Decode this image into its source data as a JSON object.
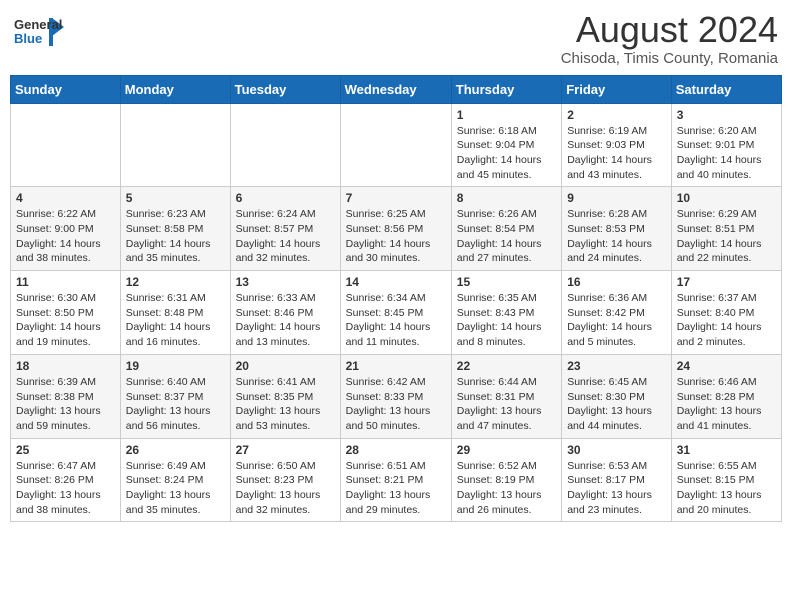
{
  "header": {
    "logo_general": "General",
    "logo_blue": "Blue",
    "month_year": "August 2024",
    "location": "Chisoda, Timis County, Romania"
  },
  "days_of_week": [
    "Sunday",
    "Monday",
    "Tuesday",
    "Wednesday",
    "Thursday",
    "Friday",
    "Saturday"
  ],
  "weeks": [
    [
      {
        "day": "",
        "info": ""
      },
      {
        "day": "",
        "info": ""
      },
      {
        "day": "",
        "info": ""
      },
      {
        "day": "",
        "info": ""
      },
      {
        "day": "1",
        "info": "Sunrise: 6:18 AM\nSunset: 9:04 PM\nDaylight: 14 hours\nand 45 minutes."
      },
      {
        "day": "2",
        "info": "Sunrise: 6:19 AM\nSunset: 9:03 PM\nDaylight: 14 hours\nand 43 minutes."
      },
      {
        "day": "3",
        "info": "Sunrise: 6:20 AM\nSunset: 9:01 PM\nDaylight: 14 hours\nand 40 minutes."
      }
    ],
    [
      {
        "day": "4",
        "info": "Sunrise: 6:22 AM\nSunset: 9:00 PM\nDaylight: 14 hours\nand 38 minutes."
      },
      {
        "day": "5",
        "info": "Sunrise: 6:23 AM\nSunset: 8:58 PM\nDaylight: 14 hours\nand 35 minutes."
      },
      {
        "day": "6",
        "info": "Sunrise: 6:24 AM\nSunset: 8:57 PM\nDaylight: 14 hours\nand 32 minutes."
      },
      {
        "day": "7",
        "info": "Sunrise: 6:25 AM\nSunset: 8:56 PM\nDaylight: 14 hours\nand 30 minutes."
      },
      {
        "day": "8",
        "info": "Sunrise: 6:26 AM\nSunset: 8:54 PM\nDaylight: 14 hours\nand 27 minutes."
      },
      {
        "day": "9",
        "info": "Sunrise: 6:28 AM\nSunset: 8:53 PM\nDaylight: 14 hours\nand 24 minutes."
      },
      {
        "day": "10",
        "info": "Sunrise: 6:29 AM\nSunset: 8:51 PM\nDaylight: 14 hours\nand 22 minutes."
      }
    ],
    [
      {
        "day": "11",
        "info": "Sunrise: 6:30 AM\nSunset: 8:50 PM\nDaylight: 14 hours\nand 19 minutes."
      },
      {
        "day": "12",
        "info": "Sunrise: 6:31 AM\nSunset: 8:48 PM\nDaylight: 14 hours\nand 16 minutes."
      },
      {
        "day": "13",
        "info": "Sunrise: 6:33 AM\nSunset: 8:46 PM\nDaylight: 14 hours\nand 13 minutes."
      },
      {
        "day": "14",
        "info": "Sunrise: 6:34 AM\nSunset: 8:45 PM\nDaylight: 14 hours\nand 11 minutes."
      },
      {
        "day": "15",
        "info": "Sunrise: 6:35 AM\nSunset: 8:43 PM\nDaylight: 14 hours\nand 8 minutes."
      },
      {
        "day": "16",
        "info": "Sunrise: 6:36 AM\nSunset: 8:42 PM\nDaylight: 14 hours\nand 5 minutes."
      },
      {
        "day": "17",
        "info": "Sunrise: 6:37 AM\nSunset: 8:40 PM\nDaylight: 14 hours\nand 2 minutes."
      }
    ],
    [
      {
        "day": "18",
        "info": "Sunrise: 6:39 AM\nSunset: 8:38 PM\nDaylight: 13 hours\nand 59 minutes."
      },
      {
        "day": "19",
        "info": "Sunrise: 6:40 AM\nSunset: 8:37 PM\nDaylight: 13 hours\nand 56 minutes."
      },
      {
        "day": "20",
        "info": "Sunrise: 6:41 AM\nSunset: 8:35 PM\nDaylight: 13 hours\nand 53 minutes."
      },
      {
        "day": "21",
        "info": "Sunrise: 6:42 AM\nSunset: 8:33 PM\nDaylight: 13 hours\nand 50 minutes."
      },
      {
        "day": "22",
        "info": "Sunrise: 6:44 AM\nSunset: 8:31 PM\nDaylight: 13 hours\nand 47 minutes."
      },
      {
        "day": "23",
        "info": "Sunrise: 6:45 AM\nSunset: 8:30 PM\nDaylight: 13 hours\nand 44 minutes."
      },
      {
        "day": "24",
        "info": "Sunrise: 6:46 AM\nSunset: 8:28 PM\nDaylight: 13 hours\nand 41 minutes."
      }
    ],
    [
      {
        "day": "25",
        "info": "Sunrise: 6:47 AM\nSunset: 8:26 PM\nDaylight: 13 hours\nand 38 minutes."
      },
      {
        "day": "26",
        "info": "Sunrise: 6:49 AM\nSunset: 8:24 PM\nDaylight: 13 hours\nand 35 minutes."
      },
      {
        "day": "27",
        "info": "Sunrise: 6:50 AM\nSunset: 8:23 PM\nDaylight: 13 hours\nand 32 minutes."
      },
      {
        "day": "28",
        "info": "Sunrise: 6:51 AM\nSunset: 8:21 PM\nDaylight: 13 hours\nand 29 minutes."
      },
      {
        "day": "29",
        "info": "Sunrise: 6:52 AM\nSunset: 8:19 PM\nDaylight: 13 hours\nand 26 minutes."
      },
      {
        "day": "30",
        "info": "Sunrise: 6:53 AM\nSunset: 8:17 PM\nDaylight: 13 hours\nand 23 minutes."
      },
      {
        "day": "31",
        "info": "Sunrise: 6:55 AM\nSunset: 8:15 PM\nDaylight: 13 hours\nand 20 minutes."
      }
    ]
  ]
}
